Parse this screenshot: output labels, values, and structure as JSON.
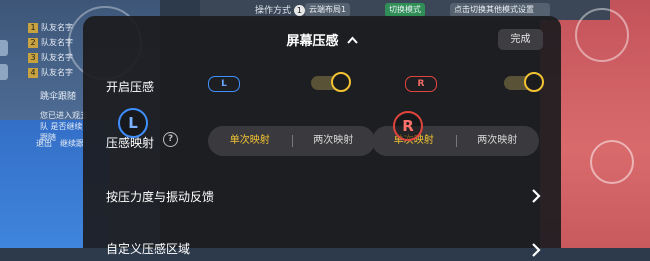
{
  "hud": {
    "team": [
      "队友名字",
      "队友名字",
      "队友名字",
      "队友名字"
    ],
    "team_nums": [
      "1",
      "2",
      "3",
      "4"
    ],
    "topbar": {
      "mode_label": "操作方式",
      "mode_num": "1",
      "cloud_layout": "云端布局1",
      "switch_mode": "切换模式",
      "switch_hint": "点击切换其他模式设置"
    },
    "follow_label": "跳伞跟随",
    "hint_text": "您已进入观五队 是否继续跟随",
    "exit_label": "退出",
    "follow_continue": "继续跟"
  },
  "modal": {
    "title": "屏幕压感",
    "done_label": "完成",
    "rows": {
      "enable_label": "开启压感",
      "mapping_label": "压感映射",
      "feedback_label": "按压力度与振动反馈",
      "custom_label": "自定义压感区域"
    },
    "l_tag": "L",
    "r_tag": "R",
    "l_badge": "L",
    "r_badge": "R",
    "mapping_left": {
      "option_a": "单次映射",
      "option_b": "两次映射"
    },
    "mapping_right": {
      "option_a": "单次映射",
      "option_b": "两次映射"
    },
    "help_glyph": "?",
    "toggle_left_on": true,
    "toggle_right_on": true
  },
  "colors": {
    "accent_yellow": "#f2c232",
    "left_blue": "#3f8fff",
    "right_red": "#e2443e",
    "modal_bg": "#1c1c1f"
  }
}
